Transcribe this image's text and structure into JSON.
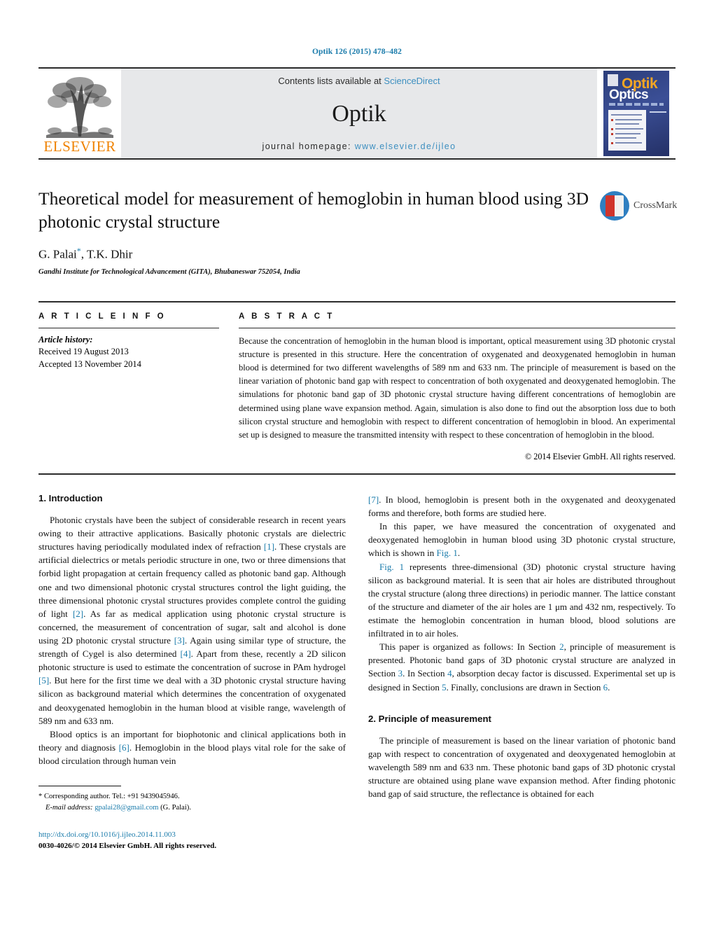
{
  "running_head": "Optik 126 (2015) 478–482",
  "masthead": {
    "publisher_name": "ELSEVIER",
    "contents_prefix": "Contents lists available at",
    "contents_link": "ScienceDirect",
    "journal_title": "Optik",
    "homepage_prefix": "journal homepage:",
    "homepage_url": "www.elsevier.de/ijleo",
    "cover": {
      "title_top": "Optik",
      "title_bottom": "Optics"
    }
  },
  "article": {
    "title": "Theoretical model for measurement of hemoglobin in human blood using 3D photonic crystal structure",
    "authors": "G. Palai",
    "authors_marker": "*",
    "authors_rest": ", T.K. Dhir",
    "affiliation": "Gandhi Institute for Technological Advancement (GITA), Bhubaneswar 752054, India",
    "crossmark_label": "CrossMark"
  },
  "article_info": {
    "heading": "A R T I C L E   I N F O",
    "history_label": "Article history:",
    "received": "Received 19 August 2013",
    "accepted": "Accepted 13 November 2014"
  },
  "abstract": {
    "heading": "A B S T R A C T",
    "text": "Because the concentration of hemoglobin in the human blood is important, optical measurement using 3D photonic crystal structure is presented in this structure. Here the concentration of oxygenated and deoxygenated hemoglobin in human blood is determined for two different wavelengths of 589 nm and 633 nm. The principle of measurement is based on the linear variation of photonic band gap with respect to concentration of both oxygenated and deoxygenated hemoglobin. The simulations for photonic band gap of 3D photonic crystal structure having different concentrations of hemoglobin are determined using plane wave expansion method. Again, simulation is also done to find out the absorption loss due to both silicon crystal structure and hemoglobin with respect to different concentration of hemoglobin in blood. An experimental set up is designed to measure the transmitted intensity with respect to these concentration of hemoglobin in the blood.",
    "copyright": "© 2014 Elsevier GmbH. All rights reserved."
  },
  "sections": {
    "intro_heading": "1.  Introduction",
    "intro_p1_a": "Photonic crystals have been the subject of considerable research in recent years owing to their attractive applications. Basically photonic crystals are dielectric structures having periodically modulated index of refraction ",
    "ref1": "[1]",
    "intro_p1_b": ". These crystals are artificial dielectrics or metals periodic structure in one, two or three dimensions that forbid light propagation at certain frequency called as photonic band gap. Although one and two dimensional photonic crystal structures control the light guiding, the three dimensional photonic crystal structures provides complete control the guiding of light ",
    "ref2": "[2]",
    "intro_p1_c": ". As far as medical application using photonic crystal structure is concerned, the measurement of concentration of sugar, salt and alcohol is done using 2D photonic crystal structure ",
    "ref3": "[3]",
    "intro_p1_d": ". Again using similar type of structure, the strength of Cygel is also determined ",
    "ref4": "[4]",
    "intro_p1_e": ". Apart from these, recently a 2D silicon photonic structure is used to estimate the concentration of sucrose in PAm hydrogel ",
    "ref5": "[5]",
    "intro_p1_f": ". But here for the first time we deal with a 3D photonic crystal structure having silicon as background material which determines the concentration of oxygenated and deoxygenated hemoglobin in the human blood at visible range, wavelength of 589 nm and 633 nm.",
    "intro_p2_a": "Blood optics is an important for biophotonic and clinical applications both in theory and diagnosis ",
    "ref6": "[6]",
    "intro_p2_b": ". Hemoglobin in the blood plays vital role for the sake of blood circulation through human vein ",
    "ref7": "[7]",
    "intro_p2_c": ". In blood, hemoglobin is present both in the oxygenated and deoxygenated forms and therefore, both forms are studied here.",
    "intro_p3_a": "In this paper, we have measured the concentration of oxygenated and deoxygenated hemoglobin in human blood using 3D photonic crystal structure, which is shown in ",
    "fig1_ref_a": "Fig. 1",
    "intro_p3_b": ".",
    "intro_p4_a": "Fig. 1",
    "intro_p4_b": " represents three-dimensional (3D) photonic crystal structure having silicon as background material. It is seen that air holes are distributed throughout the crystal structure (along three directions) in periodic manner. The lattice constant of the structure and diameter of the air holes are 1 μm and 432 nm, respectively. To estimate the hemoglobin concentration in human blood, blood solutions are infiltrated in to air holes.",
    "intro_p5_a": "This paper is organized as follows: In Section ",
    "sec_ref_2": "2",
    "intro_p5_b": ", principle of measurement is presented. Photonic band gaps of 3D photonic crystal structure are analyzed in Section ",
    "sec_ref_3": "3",
    "intro_p5_c": ". In Section ",
    "sec_ref_4": "4",
    "intro_p5_d": ", absorption decay factor is discussed. Experimental set up is designed in Section ",
    "sec_ref_5": "5",
    "intro_p5_e": ". Finally, conclusions are drawn in Section ",
    "sec_ref_6": "6",
    "intro_p5_f": ".",
    "principle_heading": "2.  Principle of measurement",
    "principle_p1": "The principle of measurement is based on the linear variation of photonic band gap with respect to concentration of oxygenated and deoxygenated hemoglobin at wavelength 589 nm and 633 nm. These photonic band gaps of 3D photonic crystal structure are obtained using plane wave expansion method. After finding photonic band gap of said structure, the reflectance is obtained for each"
  },
  "footnote": {
    "star": "*",
    "corresponding": " Corresponding author. Tel.: +91 9439045946.",
    "email_label": "E-mail address:",
    "email": "gpalai28@gmail.com",
    "email_suffix": " (G. Palai)."
  },
  "doi_block": {
    "doi_url": "http://dx.doi.org/10.1016/j.ijleo.2014.11.003",
    "issn_line": "0030-4026/© 2014 Elsevier GmbH. All rights reserved."
  },
  "colors": {
    "link": "#1a7bab",
    "elsevier_orange": "#ef8200",
    "band_gray": "#e7e8ea"
  }
}
